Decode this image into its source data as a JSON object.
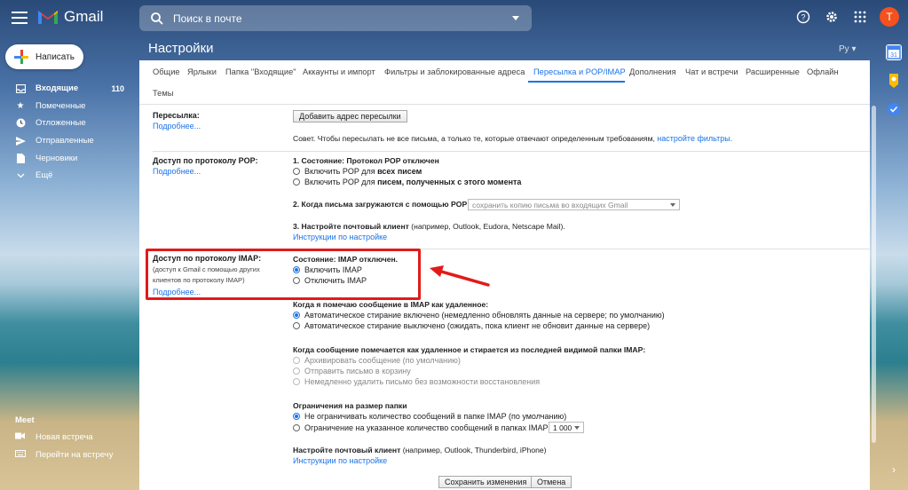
{
  "app": {
    "name": "Gmail"
  },
  "search": {
    "placeholder": "Поиск в почте"
  },
  "avatar": {
    "initial": "T"
  },
  "compose": {
    "label": "Написать"
  },
  "nav": [
    {
      "label": "Входящие",
      "count": "110",
      "icon": "inbox-icon"
    },
    {
      "label": "Помеченные",
      "icon": "star-icon"
    },
    {
      "label": "Отложенные",
      "icon": "clock-icon"
    },
    {
      "label": "Отправленные",
      "icon": "send-icon"
    },
    {
      "label": "Черновики",
      "icon": "draft-icon"
    },
    {
      "label": "Ещё",
      "icon": "chevron-down-icon"
    }
  ],
  "meet": {
    "title": "Meet",
    "new_meeting": "Новая встреча",
    "join_meeting": "Перейти на встречу"
  },
  "settings": {
    "title": "Настройки",
    "lang": "Ру"
  },
  "tabs": [
    "Общие",
    "Ярлыки",
    "Папка \"Входящие\"",
    "Аккаунты и импорт",
    "Фильтры и заблокированные адреса",
    "Пересылка и POP/IMAP",
    "Дополнения",
    "Чат и встречи",
    "Расширенные",
    "Офлайн",
    "Темы"
  ],
  "forwarding": {
    "label": "Пересылка:",
    "more": "Подробнее...",
    "add_button": "Добавить адрес пересылки",
    "tip": "Совет. Чтобы пересылать не все письма, а только те, которые отвечают определенным требованиям,",
    "tip_link": "настройте фильтры."
  },
  "pop": {
    "label": "Доступ по протоколу POP:",
    "more": "Подробнее...",
    "status": "1. Состояние: Протокол POP отключен",
    "opt1_prefix": "Включить POP для",
    "opt1_bold": "всех писем",
    "opt2_prefix": "Включить POP для",
    "opt2_bold": "писем, полученных с этого момента",
    "when": "2. Когда письма загружаются с помощью POP",
    "when_select": "сохранить копию письма во входящих Gmail",
    "client_bold": "3. Настройте почтовый клиент",
    "client_rest": "(например, Outlook, Eudora, Netscape Mail).",
    "client_link": "Инструкции по настройке"
  },
  "imap": {
    "label": "Доступ по протоколу IMAP:",
    "desc": "(доступ к Gmail с помощью других клиентов по протоколу IMAP)",
    "more": "Подробнее...",
    "status": "Состояние: IMAP отключен.",
    "enable": "Включить IMAP",
    "disable": "Отключить IMAP",
    "deleted_title": "Когда я помечаю сообщение в IMAP как удаленное:",
    "auto_on": "Автоматическое стирание включено (немедленно обновлять данные на сервере; по умолчанию)",
    "auto_off": "Автоматическое стирание выключено (ожидать, пока клиент не обновит данные на сервере)",
    "expunge_title": "Когда сообщение помечается как удаленное и стирается из последней видимой папки IMAP:",
    "archive": "Архивировать сообщение (по умолчанию)",
    "trash": "Отправить письмо в корзину",
    "delete_forever": "Немедленно удалить письмо без возможности восстановления",
    "limits_title": "Ограничения на размер папки",
    "no_limit": "Не ограничивать количество сообщений в папке IMAP (по умолчанию)",
    "limit": "Ограничение на указанное количество сообщений в папках IMAP",
    "limit_value": "1 000",
    "client_bold": "Настройте почтовый клиент",
    "client_rest": "(например, Outlook, Thunderbird, iPhone)",
    "client_link": "Инструкции по настройке"
  },
  "footer": {
    "save": "Сохранить изменения",
    "cancel": "Отмена"
  },
  "colors": {
    "accent": "#1a73e8",
    "highlight": "#e21a1a",
    "avatar": "#f4511e"
  }
}
